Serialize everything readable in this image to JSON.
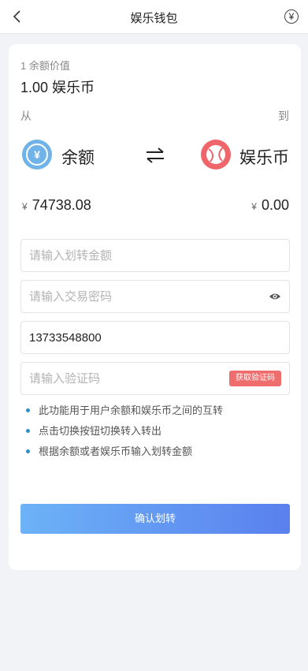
{
  "header": {
    "title": "娱乐钱包",
    "back_icon": "chevron-left-icon",
    "right_icon": "yen-circle-icon",
    "right_glyph": "¥"
  },
  "exchange": {
    "rate_label": "1 余额价值",
    "rate_value": "1.00 娱乐币",
    "from_label": "从",
    "to_label": "到",
    "from_name": "余额",
    "from_icon_glyph": "¥",
    "to_name": "娱乐币",
    "swap_icon": "swap-arrows-icon",
    "currency_symbol": "¥",
    "from_amount": "74738.08",
    "to_amount": "0.00"
  },
  "form": {
    "amount_placeholder": "请输入划转金额",
    "password_placeholder": "请输入交易密码",
    "phone_value": "13733548800",
    "code_placeholder": "请输入验证码",
    "get_code_label": "获取验证码"
  },
  "notes": [
    "此功能用于用户余额和娱乐币之间的互转",
    "点击切换按钮切换转入转出",
    "根据余额或者娱乐币输入划转金额"
  ],
  "confirm_label": "确认划转",
  "colors": {
    "balance_icon": "#6fb3e8",
    "ent_icon": "#ef6569",
    "code_button": "#f06d6d",
    "button_gradient_start": "#6cb3f7",
    "button_gradient_end": "#5a80ee",
    "note_dot": "#2c8fcd"
  }
}
